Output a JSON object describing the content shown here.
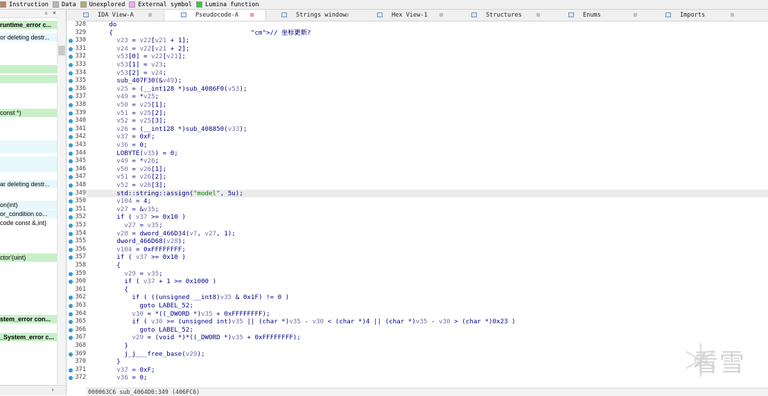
{
  "legend": [
    {
      "label": "Instruction",
      "color": "#c08060"
    },
    {
      "label": "Data",
      "color": "#b8b8b8"
    },
    {
      "label": "Unexplored",
      "color": "#b0b070"
    },
    {
      "label": "External symbol",
      "color": "#f4a8f0"
    },
    {
      "label": "Lumina function",
      "color": "#3cc83c"
    }
  ],
  "left_panel": {
    "header_controls": [
      "▫",
      "×"
    ],
    "functions": [
      {
        "text": "runtime_error c...",
        "style": "green bold"
      },
      {
        "text": "or deleting destr...",
        "style": "cyan"
      },
      {
        "text": "",
        "style": "green"
      },
      {
        "text": " const *)",
        "style": "green"
      },
      {
        "text": "",
        "style": "cyan"
      },
      {
        "text": "",
        "style": "cyan"
      },
      {
        "text": "ar deleting destr...",
        "style": "cyan"
      },
      {
        "text": "on(int)",
        "style": "cyan"
      },
      {
        "text": "or_condition co...",
        "style": "cyan"
      },
      {
        "text": "code const &,int)",
        "style": "plain"
      },
      {
        "text": "ctor'(uint)",
        "style": "green"
      },
      {
        "text": "stem_error con...",
        "style": "green bold"
      },
      {
        "text": "_System_error c...",
        "style": "green bold"
      }
    ],
    "scroll_arrow": "›"
  },
  "tabs": [
    {
      "label": "IDA View-A",
      "active": false
    },
    {
      "label": "Pseudocode-A",
      "active": true
    },
    {
      "label": "Strings window",
      "active": false
    },
    {
      "label": "Hex View-1",
      "active": false
    },
    {
      "label": "Structures",
      "active": false
    },
    {
      "label": "Enums",
      "active": false
    },
    {
      "label": "Imports",
      "active": false
    }
  ],
  "code_lines": [
    {
      "n": "328",
      "dot": false,
      "t": "      do"
    },
    {
      "n": "329",
      "dot": false,
      "t": "      {                                    // 坐标更新?"
    },
    {
      "n": "330",
      "dot": true,
      "t": "        v23 = v22[v21 + 1];"
    },
    {
      "n": "331",
      "dot": true,
      "t": "        v24 = v22[v21 + 2];"
    },
    {
      "n": "332",
      "dot": true,
      "t": "        v53[0] = v22[v21];"
    },
    {
      "n": "333",
      "dot": true,
      "t": "        v53[1] = v23;"
    },
    {
      "n": "334",
      "dot": true,
      "t": "        v53[2] = v24;"
    },
    {
      "n": "335",
      "dot": true,
      "t": "        sub_407F30(&v49);"
    },
    {
      "n": "336",
      "dot": true,
      "t": "        v25 = (__int128 *)sub_4086F0(v53);"
    },
    {
      "n": "337",
      "dot": true,
      "t": "        v49 = *v25;"
    },
    {
      "n": "338",
      "dot": true,
      "t": "        v50 = v25[1];"
    },
    {
      "n": "339",
      "dot": true,
      "t": "        v51 = v25[2];"
    },
    {
      "n": "340",
      "dot": true,
      "t": "        v52 = v25[3];"
    },
    {
      "n": "341",
      "dot": true,
      "t": "        v26 = (__int128 *)sub_408850(v33);"
    },
    {
      "n": "342",
      "dot": true,
      "t": "        v37 = 0xF;"
    },
    {
      "n": "343",
      "dot": true,
      "t": "        v36 = 0;"
    },
    {
      "n": "344",
      "dot": true,
      "t": "        LOBYTE(v35) = 0;"
    },
    {
      "n": "345",
      "dot": true,
      "t": "        v49 = *v26;"
    },
    {
      "n": "346",
      "dot": true,
      "t": "        v50 = v26[1];"
    },
    {
      "n": "347",
      "dot": true,
      "t": "        v51 = v26[2];"
    },
    {
      "n": "348",
      "dot": true,
      "t": "        v52 = v26[3];"
    },
    {
      "n": "349",
      "dot": true,
      "t": "        std::string::assign(\"model\", 5u);",
      "hl": true
    },
    {
      "n": "350",
      "dot": true,
      "t": "        v104 = 4;"
    },
    {
      "n": "351",
      "dot": true,
      "t": "        v27 = &v35;"
    },
    {
      "n": "352",
      "dot": true,
      "t": "        if ( v37 >= 0x10 )"
    },
    {
      "n": "353",
      "dot": true,
      "t": "          v27 = v35;"
    },
    {
      "n": "354",
      "dot": true,
      "t": "        v28 = dword_466D34(v7, v27, 1);"
    },
    {
      "n": "355",
      "dot": true,
      "t": "        dword_466D68(v28);"
    },
    {
      "n": "356",
      "dot": true,
      "t": "        v104 = 0xFFFFFFFF;"
    },
    {
      "n": "357",
      "dot": true,
      "t": "        if ( v37 >= 0x10 )"
    },
    {
      "n": "358",
      "dot": false,
      "t": "        {"
    },
    {
      "n": "359",
      "dot": true,
      "t": "          v29 = v35;"
    },
    {
      "n": "360",
      "dot": true,
      "t": "          if ( v37 + 1 >= 0x1000 )"
    },
    {
      "n": "361",
      "dot": false,
      "t": "          {"
    },
    {
      "n": "362",
      "dot": true,
      "t": "            if ( ((unsigned __int8)v35 & 0x1F) != 0 )"
    },
    {
      "n": "363",
      "dot": true,
      "t": "              goto LABEL_52;"
    },
    {
      "n": "364",
      "dot": true,
      "t": "            v30 = *((_DWORD *)v35 + 0xFFFFFFFF);"
    },
    {
      "n": "365",
      "dot": true,
      "t": "            if ( v30 >= (unsigned int)v35 || (char *)v35 - v30 < (char *)4 || (char *)v35 - v30 > (char *)0x23 )"
    },
    {
      "n": "366",
      "dot": true,
      "t": "              goto LABEL_52;"
    },
    {
      "n": "367",
      "dot": true,
      "t": "            v29 = (void *)*((_DWORD *)v35 + 0xFFFFFFFF);"
    },
    {
      "n": "368",
      "dot": false,
      "t": "          }"
    },
    {
      "n": "369",
      "dot": true,
      "t": "          j_j___free_base(v29);"
    },
    {
      "n": "370",
      "dot": false,
      "t": "        }"
    },
    {
      "n": "371",
      "dot": true,
      "t": "        v37 = 0xF;"
    },
    {
      "n": "372",
      "dot": true,
      "t": "        v36 = 0;"
    }
  ],
  "status_text": "000063C6 sub_4064D0:349 (406FC6)",
  "watermark_text": "看雪"
}
